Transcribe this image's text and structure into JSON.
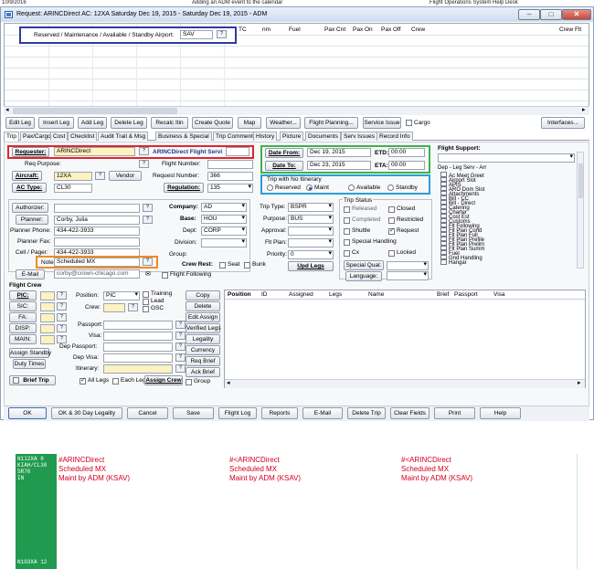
{
  "header": {
    "left": "10/9/2016",
    "center": "Adding an ADM event to the calendar",
    "right": "Flight Operations System Help Desk"
  },
  "window": {
    "title": "Request: ARINCDirect  AC: 12XA  Saturday Dec 19, 2015 - Saturday Dec 19, 2015 - ADM",
    "buttons": [
      "–",
      "□",
      "✕"
    ]
  },
  "grid": {
    "airport_label": "Reserved / Maintenance / Available / Standby Airport:",
    "airport_value": "SAV",
    "columns": [
      "TC",
      "nm",
      "Fuel",
      "Pax Cnt",
      "Pax On",
      "Pax Off",
      "Crew",
      "Crew Flt"
    ]
  },
  "toolbar": [
    "Edit Leg",
    "Insert Leg",
    "Add Leg",
    "Delete Leg",
    "Recalc Itin",
    "Create Quote",
    "Map",
    "Weather...",
    "Flight Planning...",
    "Service Issue"
  ],
  "cargo_label": "Cargo",
  "interfaces_label": "Interfaces...",
  "tabs": [
    "Trip",
    "Pax/Cargo",
    "Cost",
    "Checklist",
    "Audit Trail & Msg",
    "Business & Special",
    "Trip Comment",
    "History",
    "Picture",
    "Documents",
    "Serv Issues",
    "Record Info"
  ],
  "trip": {
    "requester_label": "Requester:",
    "requester_value": "ARINCDirect",
    "requester_name": "ARINCDirect Flight Servi",
    "req_purpose_label": "Req Purpose:",
    "flight_number_label": "Flight Number:",
    "aircraft_label": "Aircraft:",
    "aircraft_value": "12XA",
    "vendor_label": "Vendor",
    "request_number_label": "Request Number:",
    "request_number_value": "366",
    "ac_type_label": "AC Type:",
    "ac_type_value": "CL30",
    "regulation_label": "Regulation:",
    "regulation_value": "135",
    "date_from_label": "Date From:",
    "date_from_value": "Dec 19, 2015",
    "etd_label": "ETD:",
    "etd_value": "00:00",
    "date_to_label": "Date To:",
    "date_to_value": "Dec 23, 2015",
    "eta_label": "ETA:",
    "eta_value": "00:00",
    "no_itin_label": "Trip with No Itinerary",
    "radios": [
      "Reserved",
      "Maint",
      "Available",
      "Standby"
    ],
    "selected_radio": "Maint"
  },
  "flight_support": {
    "title": "Flight Support:",
    "dep_label": "Dep - Leg Serv - Arr",
    "items": [
      "Ac Meet Greet",
      "Airport Slot",
      "APIS",
      "ARO Dom Slot",
      "Attachments",
      "Bill - CC",
      "Bill - Direct",
      "Catering",
      "Charter",
      "Cost Est",
      "Customs",
      "Flt Following",
      "Flt Plan Cond",
      "Flt Plan Full",
      "Flt Plan Prefile",
      "Flt Plan Prelim",
      "Flt Plan Summ",
      "Fuel",
      "Gnd Handling",
      "Hangar"
    ]
  },
  "people": {
    "authorizer_label": "Authorizer:",
    "planner_label": "Planner:",
    "planner_value": "Corby, Julia",
    "planner_phone_label": "Planner Phone:",
    "planner_phone_value": "434-422-3933",
    "planner_fax_label": "Planner Fax:",
    "cell_label": "Cell / Pager:",
    "cell_value": "434-422-3933",
    "note_label": "Note:",
    "note_value": "Scheduled MX",
    "email_label": "E-Mail",
    "email_value": "corby@crown-chicago.com"
  },
  "company": {
    "company_label": "Company:",
    "company_value": "AD",
    "base_label": "Base:",
    "base_value": "HOU",
    "dept_label": "Dept:",
    "dept_value": "CORP",
    "division_label": "Division:",
    "group_label": "Group:",
    "crew_rest_label": "Crew Rest:",
    "seat_label": "Seat",
    "bunk_label": "Bunk",
    "flight_following_label": "Flight Following"
  },
  "trip_type": {
    "trip_type_label": "Trip Type:",
    "trip_type_value": "BSPR",
    "purpose_label": "Purpose:",
    "purpose_value": "BUS",
    "approval_label": "Approval:",
    "flt_plan_label": "Flt Plan:",
    "priority_label": "Priority:",
    "priority_value": "0",
    "upd_legs_label": "Upd Legs"
  },
  "trip_status": {
    "title": "Trip Status",
    "items": [
      {
        "label": "Released",
        "checked": false
      },
      {
        "label": "Closed",
        "checked": false
      },
      {
        "label": "Completed",
        "checked": false
      },
      {
        "label": "Restricted",
        "checked": false
      },
      {
        "label": "Shuttle",
        "checked": false
      },
      {
        "label": "Request",
        "checked": true
      },
      {
        "label": "Special Handling",
        "checked": false
      },
      {
        "label": "Cx",
        "checked": false
      },
      {
        "label": "Locked",
        "checked": false
      }
    ],
    "special_qual_label": "Special Qual:",
    "language_label": "Language:"
  },
  "crew": {
    "title": "Flight Crew",
    "roles": [
      "PIC:",
      "SIC:",
      "FA:",
      "DISP:",
      "MAIN:"
    ],
    "position_label": "Position:",
    "position_value": "PIC",
    "crew_label": "Crew:",
    "training_label": "Training",
    "lead_label": "Lead",
    "gsc_label": "GSC",
    "passport_label": "Passport:",
    "visa_label": "Visa:",
    "dep_passport_label": "Dep Passport:",
    "dep_visa_label": "Dep Visa:",
    "itinerary_label": "Itinerary:",
    "side_buttons": [
      "Copy",
      "Delete",
      "Edit Assign",
      "Verified Legs",
      "Legality",
      "Currency",
      "Req Brief",
      "Ack Brief"
    ],
    "group_label": "Group",
    "assign_standby": "Assign Standby",
    "duty_times": "Duty Times",
    "brief_trip": "Brief Trip",
    "all_legs": "All Legs",
    "each_leg": "Each Leg",
    "assign_crew": "Assign Crew",
    "table_columns": [
      "Position",
      "ID",
      "Assigned",
      "Legs",
      "Name",
      "Brief",
      "Passport",
      "Visa"
    ]
  },
  "bottom_buttons": [
    "OK",
    "OK & 30 Day Legality",
    "Cancel",
    "Save",
    "Flight Log",
    "Reports",
    "E-Mail",
    "Delete Trip",
    "Clear Fields",
    "Print",
    "Help"
  ],
  "schedule": {
    "row_label": [
      "N112XA 8",
      "KIAH/CL30",
      "SR76",
      "IN"
    ],
    "row_label_next": "N103XA 12",
    "cells": [
      {
        "title": "#ARINCDirect",
        "line1": "Scheduled MX",
        "line2": "Maint by ADM (KSAV)"
      },
      {
        "title": "#<ARINCDirect",
        "line1": "Scheduled MX",
        "line2": "Maint by ADM (KSAV)"
      },
      {
        "title": "#<ARINCDirect",
        "line1": "Scheduled MX",
        "line2": "Maint by ADM (KSAV)"
      }
    ]
  },
  "colors": {
    "red_box": "#e0252a",
    "blue_box": "#2e3ca0",
    "green_box": "#3bb44a",
    "light_blue_box": "#2a9fd6",
    "orange_box": "#f08a24",
    "schedule_green": "#1f9a4e",
    "schedule_text": "#d1001f"
  }
}
